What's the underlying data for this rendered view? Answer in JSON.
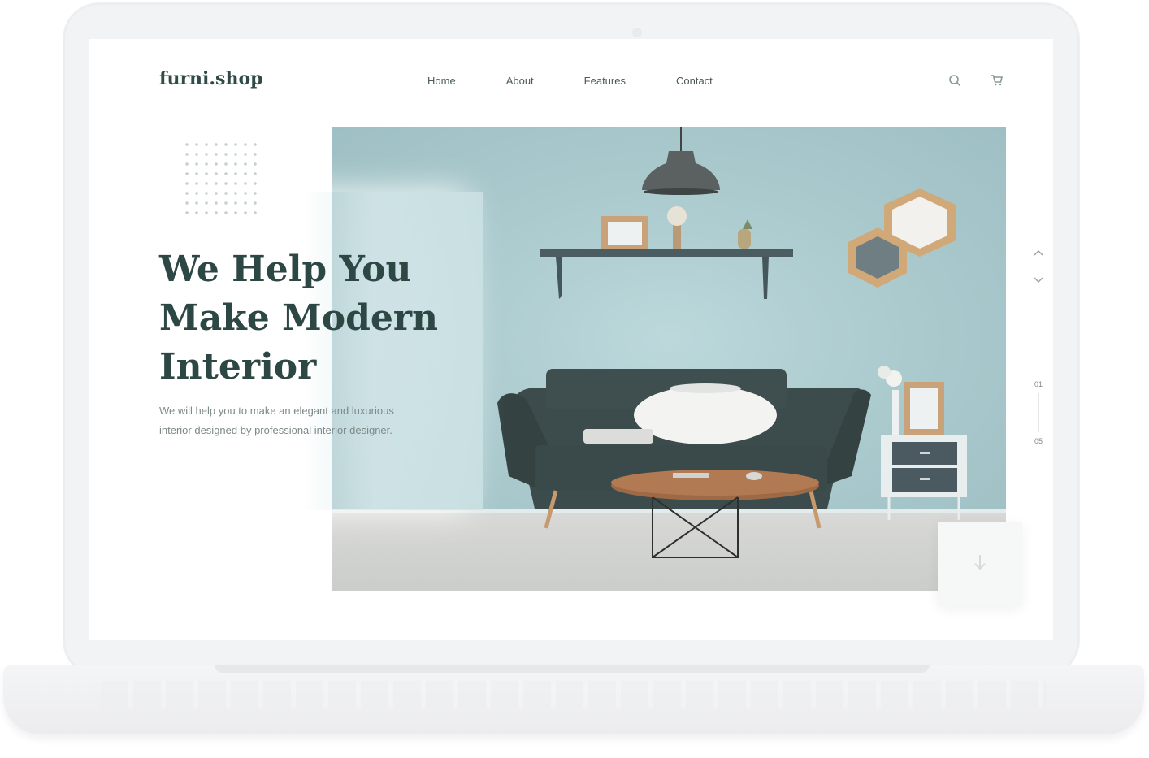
{
  "site": {
    "logo": "furni.shop",
    "nav": [
      "Home",
      "About",
      "Features",
      "Contact"
    ],
    "icons": [
      "search-icon",
      "cart-icon"
    ]
  },
  "hero": {
    "headline": "We Help You\nMake Modern\nInterior",
    "description": "We will help you to make an elegant and luxurious interior designed by professional interior designer.",
    "pager": {
      "current": "01",
      "total": "05"
    },
    "scroll_icon": "arrow-down-icon"
  },
  "colors": {
    "accent": "#2d4744",
    "wall": "#a7c8cc",
    "sofa": "#3c4b4b"
  }
}
